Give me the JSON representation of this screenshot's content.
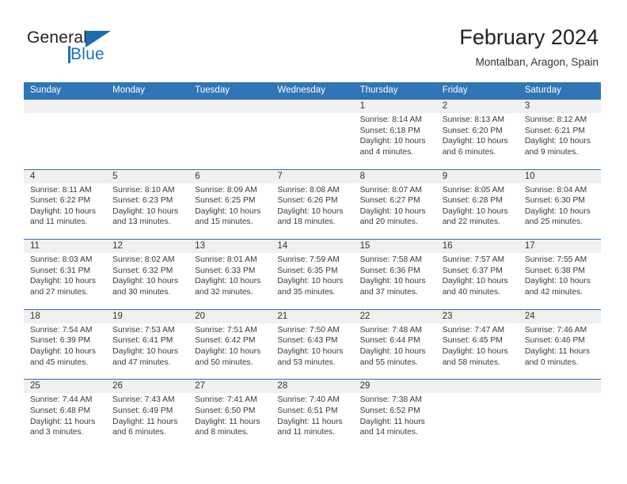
{
  "brand": {
    "name_top": "General",
    "name_bottom": "Blue",
    "accent_color": "#1b75bb"
  },
  "header": {
    "title": "February 2024",
    "location": "Montalban, Aragon, Spain"
  },
  "theme": {
    "header_blue": "#3075b5",
    "row_divider": "#2f6fae",
    "date_band": "#f0f0f0"
  },
  "weekdays": [
    "Sunday",
    "Monday",
    "Tuesday",
    "Wednesday",
    "Thursday",
    "Friday",
    "Saturday"
  ],
  "weeks": [
    [
      {
        "day": "",
        "sunrise": "",
        "sunset": "",
        "daylight_1": "",
        "daylight_2": "",
        "empty": true
      },
      {
        "day": "",
        "sunrise": "",
        "sunset": "",
        "daylight_1": "",
        "daylight_2": "",
        "empty": true
      },
      {
        "day": "",
        "sunrise": "",
        "sunset": "",
        "daylight_1": "",
        "daylight_2": "",
        "empty": true
      },
      {
        "day": "",
        "sunrise": "",
        "sunset": "",
        "daylight_1": "",
        "daylight_2": "",
        "empty": true
      },
      {
        "day": "1",
        "sunrise": "Sunrise: 8:14 AM",
        "sunset": "Sunset: 6:18 PM",
        "daylight_1": "Daylight: 10 hours",
        "daylight_2": "and 4 minutes."
      },
      {
        "day": "2",
        "sunrise": "Sunrise: 8:13 AM",
        "sunset": "Sunset: 6:20 PM",
        "daylight_1": "Daylight: 10 hours",
        "daylight_2": "and 6 minutes."
      },
      {
        "day": "3",
        "sunrise": "Sunrise: 8:12 AM",
        "sunset": "Sunset: 6:21 PM",
        "daylight_1": "Daylight: 10 hours",
        "daylight_2": "and 9 minutes."
      }
    ],
    [
      {
        "day": "4",
        "sunrise": "Sunrise: 8:11 AM",
        "sunset": "Sunset: 6:22 PM",
        "daylight_1": "Daylight: 10 hours",
        "daylight_2": "and 11 minutes."
      },
      {
        "day": "5",
        "sunrise": "Sunrise: 8:10 AM",
        "sunset": "Sunset: 6:23 PM",
        "daylight_1": "Daylight: 10 hours",
        "daylight_2": "and 13 minutes."
      },
      {
        "day": "6",
        "sunrise": "Sunrise: 8:09 AM",
        "sunset": "Sunset: 6:25 PM",
        "daylight_1": "Daylight: 10 hours",
        "daylight_2": "and 15 minutes."
      },
      {
        "day": "7",
        "sunrise": "Sunrise: 8:08 AM",
        "sunset": "Sunset: 6:26 PM",
        "daylight_1": "Daylight: 10 hours",
        "daylight_2": "and 18 minutes."
      },
      {
        "day": "8",
        "sunrise": "Sunrise: 8:07 AM",
        "sunset": "Sunset: 6:27 PM",
        "daylight_1": "Daylight: 10 hours",
        "daylight_2": "and 20 minutes."
      },
      {
        "day": "9",
        "sunrise": "Sunrise: 8:05 AM",
        "sunset": "Sunset: 6:28 PM",
        "daylight_1": "Daylight: 10 hours",
        "daylight_2": "and 22 minutes."
      },
      {
        "day": "10",
        "sunrise": "Sunrise: 8:04 AM",
        "sunset": "Sunset: 6:30 PM",
        "daylight_1": "Daylight: 10 hours",
        "daylight_2": "and 25 minutes."
      }
    ],
    [
      {
        "day": "11",
        "sunrise": "Sunrise: 8:03 AM",
        "sunset": "Sunset: 6:31 PM",
        "daylight_1": "Daylight: 10 hours",
        "daylight_2": "and 27 minutes."
      },
      {
        "day": "12",
        "sunrise": "Sunrise: 8:02 AM",
        "sunset": "Sunset: 6:32 PM",
        "daylight_1": "Daylight: 10 hours",
        "daylight_2": "and 30 minutes."
      },
      {
        "day": "13",
        "sunrise": "Sunrise: 8:01 AM",
        "sunset": "Sunset: 6:33 PM",
        "daylight_1": "Daylight: 10 hours",
        "daylight_2": "and 32 minutes."
      },
      {
        "day": "14",
        "sunrise": "Sunrise: 7:59 AM",
        "sunset": "Sunset: 6:35 PM",
        "daylight_1": "Daylight: 10 hours",
        "daylight_2": "and 35 minutes."
      },
      {
        "day": "15",
        "sunrise": "Sunrise: 7:58 AM",
        "sunset": "Sunset: 6:36 PM",
        "daylight_1": "Daylight: 10 hours",
        "daylight_2": "and 37 minutes."
      },
      {
        "day": "16",
        "sunrise": "Sunrise: 7:57 AM",
        "sunset": "Sunset: 6:37 PM",
        "daylight_1": "Daylight: 10 hours",
        "daylight_2": "and 40 minutes."
      },
      {
        "day": "17",
        "sunrise": "Sunrise: 7:55 AM",
        "sunset": "Sunset: 6:38 PM",
        "daylight_1": "Daylight: 10 hours",
        "daylight_2": "and 42 minutes."
      }
    ],
    [
      {
        "day": "18",
        "sunrise": "Sunrise: 7:54 AM",
        "sunset": "Sunset: 6:39 PM",
        "daylight_1": "Daylight: 10 hours",
        "daylight_2": "and 45 minutes."
      },
      {
        "day": "19",
        "sunrise": "Sunrise: 7:53 AM",
        "sunset": "Sunset: 6:41 PM",
        "daylight_1": "Daylight: 10 hours",
        "daylight_2": "and 47 minutes."
      },
      {
        "day": "20",
        "sunrise": "Sunrise: 7:51 AM",
        "sunset": "Sunset: 6:42 PM",
        "daylight_1": "Daylight: 10 hours",
        "daylight_2": "and 50 minutes."
      },
      {
        "day": "21",
        "sunrise": "Sunrise: 7:50 AM",
        "sunset": "Sunset: 6:43 PM",
        "daylight_1": "Daylight: 10 hours",
        "daylight_2": "and 53 minutes."
      },
      {
        "day": "22",
        "sunrise": "Sunrise: 7:48 AM",
        "sunset": "Sunset: 6:44 PM",
        "daylight_1": "Daylight: 10 hours",
        "daylight_2": "and 55 minutes."
      },
      {
        "day": "23",
        "sunrise": "Sunrise: 7:47 AM",
        "sunset": "Sunset: 6:45 PM",
        "daylight_1": "Daylight: 10 hours",
        "daylight_2": "and 58 minutes."
      },
      {
        "day": "24",
        "sunrise": "Sunrise: 7:46 AM",
        "sunset": "Sunset: 6:46 PM",
        "daylight_1": "Daylight: 11 hours",
        "daylight_2": "and 0 minutes."
      }
    ],
    [
      {
        "day": "25",
        "sunrise": "Sunrise: 7:44 AM",
        "sunset": "Sunset: 6:48 PM",
        "daylight_1": "Daylight: 11 hours",
        "daylight_2": "and 3 minutes."
      },
      {
        "day": "26",
        "sunrise": "Sunrise: 7:43 AM",
        "sunset": "Sunset: 6:49 PM",
        "daylight_1": "Daylight: 11 hours",
        "daylight_2": "and 6 minutes."
      },
      {
        "day": "27",
        "sunrise": "Sunrise: 7:41 AM",
        "sunset": "Sunset: 6:50 PM",
        "daylight_1": "Daylight: 11 hours",
        "daylight_2": "and 8 minutes."
      },
      {
        "day": "28",
        "sunrise": "Sunrise: 7:40 AM",
        "sunset": "Sunset: 6:51 PM",
        "daylight_1": "Daylight: 11 hours",
        "daylight_2": "and 11 minutes."
      },
      {
        "day": "29",
        "sunrise": "Sunrise: 7:38 AM",
        "sunset": "Sunset: 6:52 PM",
        "daylight_1": "Daylight: 11 hours",
        "daylight_2": "and 14 minutes."
      },
      {
        "day": "",
        "sunrise": "",
        "sunset": "",
        "daylight_1": "",
        "daylight_2": "",
        "empty": true
      },
      {
        "day": "",
        "sunrise": "",
        "sunset": "",
        "daylight_1": "",
        "daylight_2": "",
        "empty": true
      }
    ]
  ]
}
